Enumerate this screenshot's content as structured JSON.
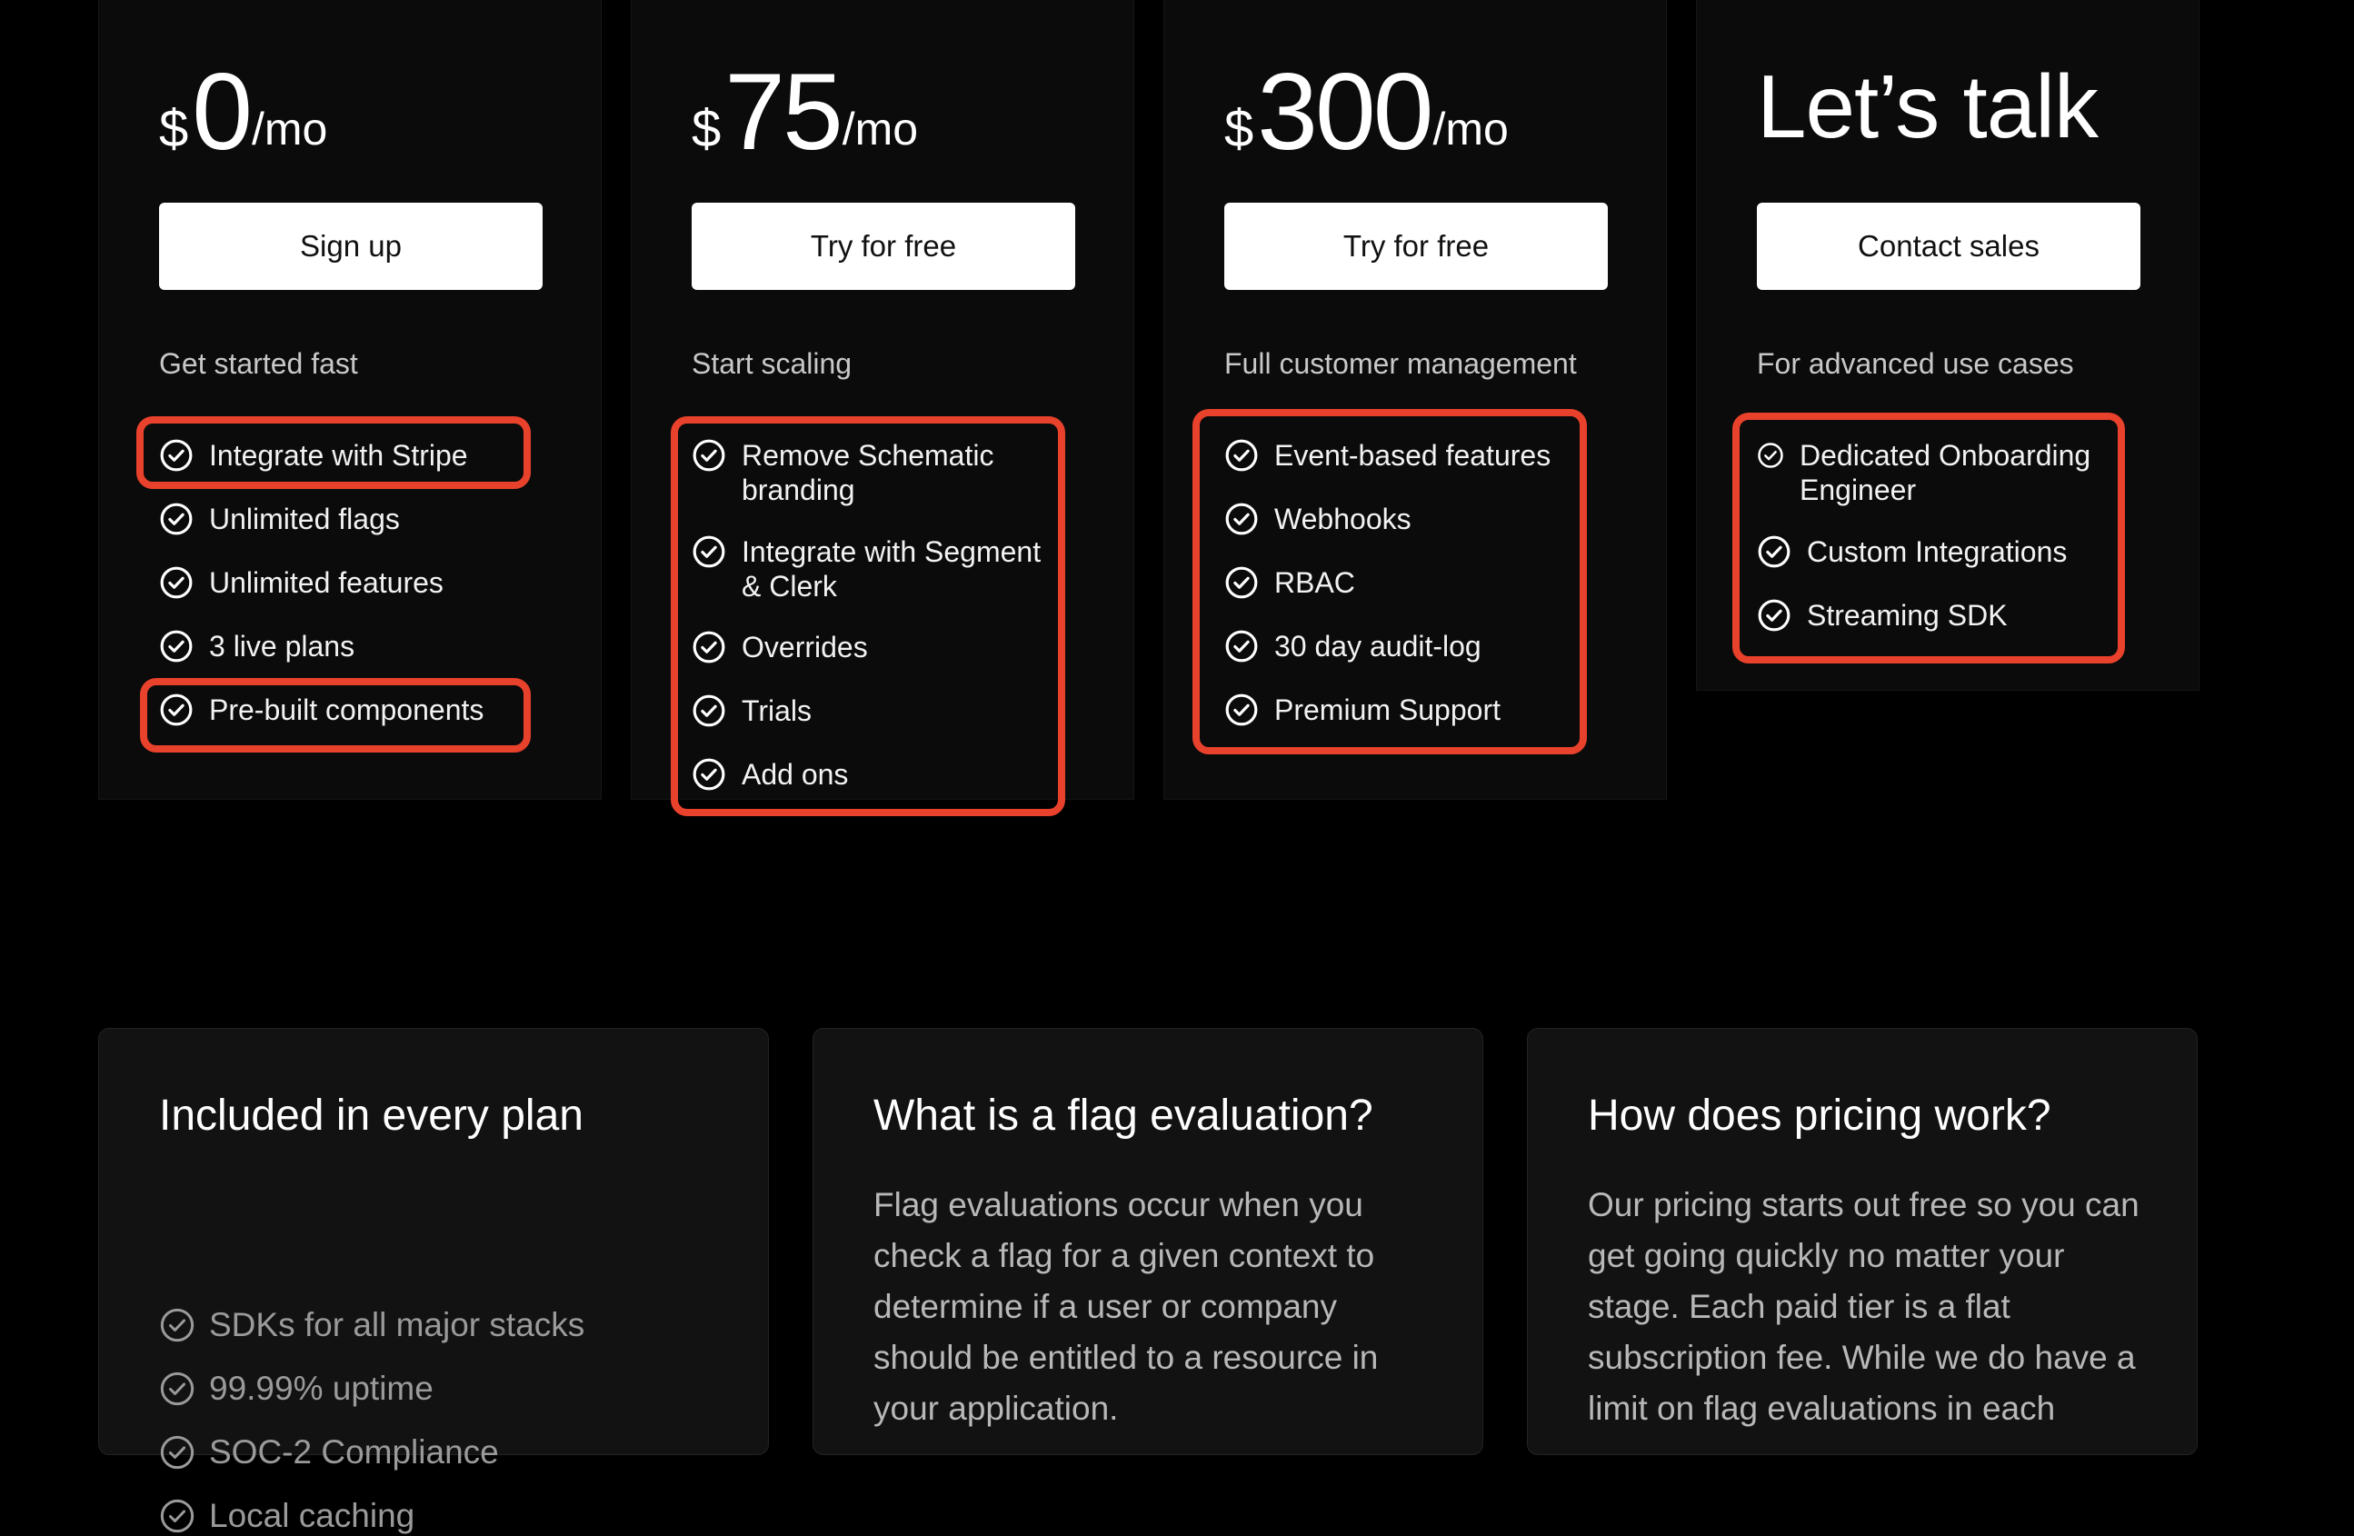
{
  "plans": [
    {
      "currency": "$",
      "amount": "0",
      "period": "/mo",
      "cta": "Sign up",
      "subtitle": "Get started fast",
      "features": [
        {
          "lines": [
            "Integrate with Stripe"
          ]
        },
        {
          "lines": [
            "Unlimited flags"
          ]
        },
        {
          "lines": [
            "Unlimited features"
          ]
        },
        {
          "lines": [
            "3 live plans"
          ]
        },
        {
          "lines": [
            "Pre-built components"
          ]
        }
      ]
    },
    {
      "currency": "$",
      "amount": "75",
      "period": "/mo",
      "cta": "Try for free",
      "subtitle": "Start scaling",
      "features": [
        {
          "lines": [
            "Remove Schematic",
            "branding"
          ]
        },
        {
          "lines": [
            "Integrate with Segment",
            "& Clerk"
          ]
        },
        {
          "lines": [
            "Overrides"
          ]
        },
        {
          "lines": [
            "Trials"
          ]
        },
        {
          "lines": [
            "Add ons"
          ]
        }
      ]
    },
    {
      "currency": "$",
      "amount": "300",
      "period": "/mo",
      "cta": "Try for free",
      "subtitle": "Full customer management",
      "features": [
        {
          "lines": [
            "Event-based features"
          ]
        },
        {
          "lines": [
            "Webhooks"
          ]
        },
        {
          "lines": [
            "RBAC"
          ]
        },
        {
          "lines": [
            "30 day audit-log"
          ]
        },
        {
          "lines": [
            "Premium Support"
          ]
        }
      ]
    },
    {
      "headline": "Let’s talk",
      "cta": "Contact sales",
      "subtitle": "For advanced use cases",
      "features": [
        {
          "lines": [
            "Dedicated Onboarding",
            "Engineer"
          ]
        },
        {
          "lines": [
            "Custom Integrations"
          ]
        },
        {
          "lines": [
            "Streaming SDK"
          ]
        }
      ]
    }
  ],
  "info_cards": [
    {
      "title": "Included in every plan",
      "items": [
        "SDKs for all major stacks",
        "99.99% uptime",
        "SOC-2 Compliance",
        "Local caching"
      ]
    },
    {
      "title": "What is a flag evaluation?",
      "body": "Flag evaluations occur when you check a flag for a given context to determine if a user or company should be entitled to a resource in your application."
    },
    {
      "title": "How does pricing work?",
      "body": "Our pricing starts out free so you can get going quickly no matter your stage. Each paid tier is a flat subscription fee. While we do have a limit on flag evaluations in each"
    }
  ],
  "colors": {
    "background": "#000000",
    "card": "#0b0b0b",
    "highlight": "#e8412c",
    "button": "#ffffff"
  },
  "icons": {
    "feature": "check-circle-icon"
  }
}
